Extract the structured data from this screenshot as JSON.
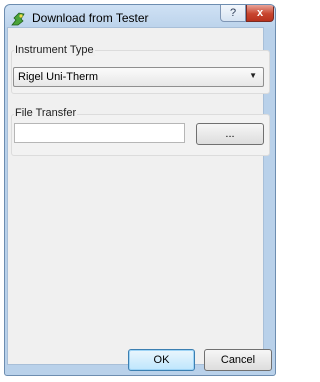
{
  "window": {
    "title": "Download from Tester",
    "app_icon": "app-icon",
    "help_label": "?",
    "close_label": "x"
  },
  "instrument_type": {
    "group_label": "Instrument Type",
    "selected_value": "Rigel Uni-Therm",
    "dropdown_arrow": "▼"
  },
  "file_transfer": {
    "group_label": "File Transfer",
    "input_value": "",
    "input_placeholder": "",
    "browse_label": "..."
  },
  "footer": {
    "ok_label": "OK",
    "cancel_label": "Cancel"
  },
  "colors": {
    "titlebar": "#b9d1ea",
    "close_button": "#c8452f",
    "default_button_border": "#3c7fb1"
  }
}
